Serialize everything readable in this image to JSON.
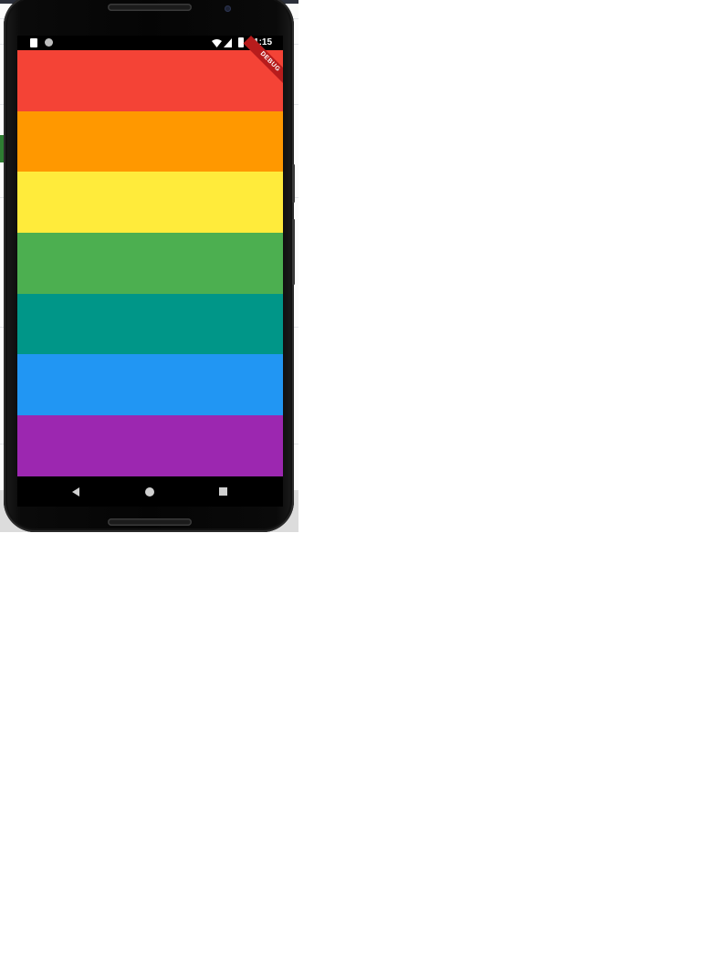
{
  "status_bar": {
    "time": "11:15",
    "icons": [
      "sd-card-icon",
      "sync-icon",
      "wifi-icon",
      "signal-icon",
      "battery-icon"
    ]
  },
  "debug_banner": {
    "label": "DEBUG"
  },
  "stripes": [
    {
      "name": "red",
      "color": "#F44336"
    },
    {
      "name": "orange",
      "color": "#FF9800"
    },
    {
      "name": "yellow",
      "color": "#FFEB3B"
    },
    {
      "name": "green",
      "color": "#4CAF50"
    },
    {
      "name": "teal",
      "color": "#009688"
    },
    {
      "name": "blue",
      "color": "#2196F3"
    },
    {
      "name": "purple",
      "color": "#9C27B0"
    }
  ],
  "nav_bar": {
    "buttons": [
      "back-icon",
      "home-icon",
      "recents-icon"
    ]
  }
}
